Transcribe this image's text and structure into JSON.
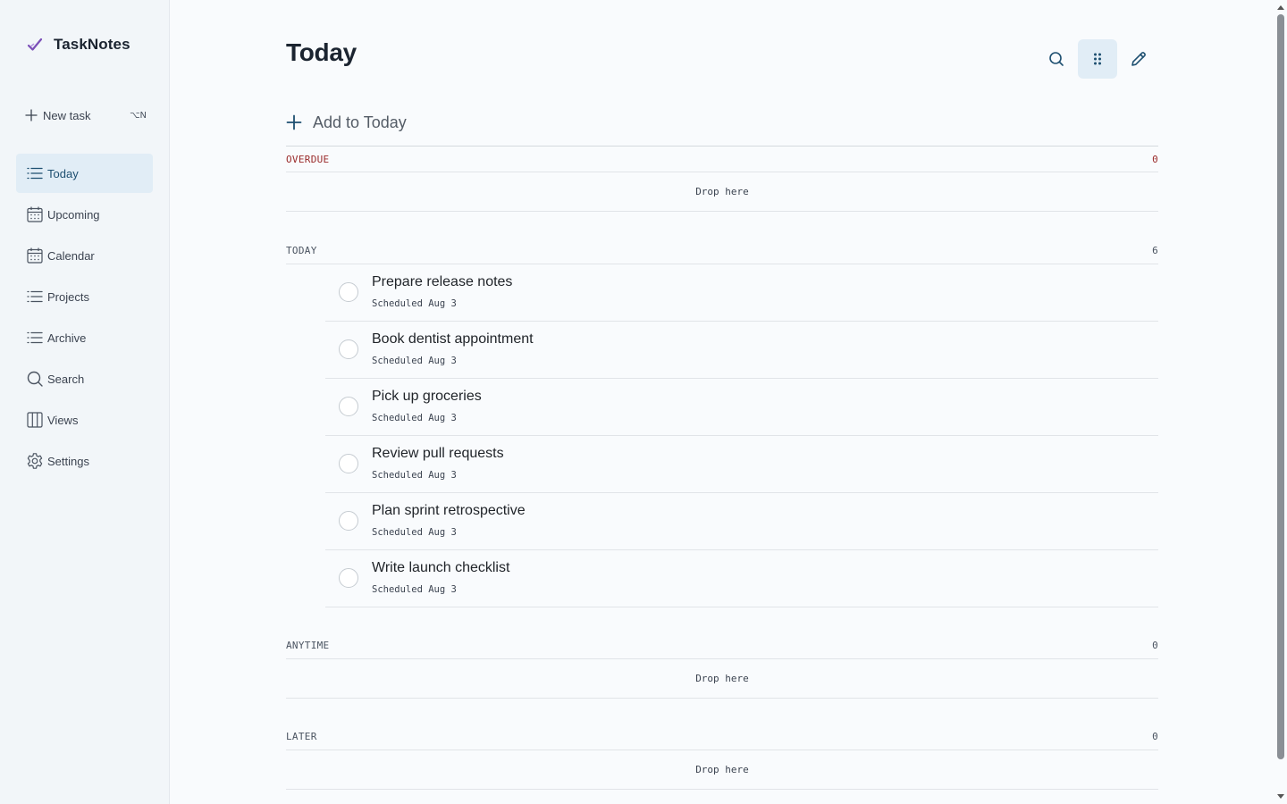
{
  "app": {
    "name": "TaskNotes"
  },
  "sidebar": {
    "new_task": {
      "label": "New task",
      "shortcut": "⌥N"
    },
    "items": [
      {
        "label": "Today",
        "icon": "list-icon",
        "active": true
      },
      {
        "label": "Upcoming",
        "icon": "calendar-icon",
        "active": false
      },
      {
        "label": "Calendar",
        "icon": "calendar-icon",
        "active": false
      },
      {
        "label": "Projects",
        "icon": "list-icon",
        "active": false
      },
      {
        "label": "Archive",
        "icon": "list-icon",
        "active": false
      },
      {
        "label": "Search",
        "icon": "search-icon",
        "active": false
      },
      {
        "label": "Views",
        "icon": "columns-icon",
        "active": false
      },
      {
        "label": "Settings",
        "icon": "gear-icon",
        "active": false
      }
    ]
  },
  "header": {
    "title": "Today",
    "toolbar": [
      {
        "name": "search",
        "icon": "search-icon"
      },
      {
        "name": "drag-handle",
        "icon": "grip-dots-icon",
        "active": true
      },
      {
        "name": "edit",
        "icon": "pencil-icon"
      }
    ]
  },
  "add_task": {
    "label": "Add to Today"
  },
  "sections": {
    "overdue": {
      "label": "OVERDUE",
      "count": "0",
      "drop_label": "Drop here"
    },
    "today": {
      "label": "TODAY",
      "count": "6",
      "tasks": [
        {
          "title": "Prepare release notes",
          "meta": "Scheduled Aug 3"
        },
        {
          "title": "Book dentist appointment",
          "meta": "Scheduled Aug 3"
        },
        {
          "title": "Pick up groceries",
          "meta": "Scheduled Aug 3"
        },
        {
          "title": "Review pull requests",
          "meta": "Scheduled Aug 3"
        },
        {
          "title": "Plan sprint retrospective",
          "meta": "Scheduled Aug 3"
        },
        {
          "title": "Write launch checklist",
          "meta": "Scheduled Aug 3"
        }
      ]
    },
    "anytime": {
      "label": "ANYTIME",
      "count": "0",
      "drop_label": "Drop here"
    },
    "later": {
      "label": "LATER",
      "count": "0",
      "drop_label": "Drop here"
    }
  },
  "colors": {
    "accent": "#1d4f70",
    "active_bg": "#e1edf6",
    "overdue": "#9a2b2b",
    "logo": "#7b4fb8"
  }
}
